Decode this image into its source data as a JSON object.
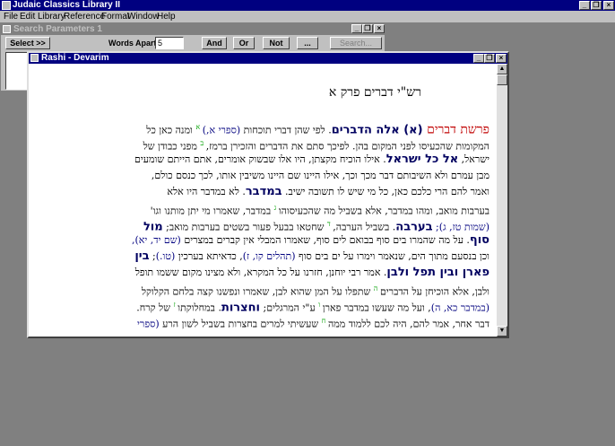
{
  "app": {
    "title": "Judaic Classics Library II",
    "menu": [
      "File",
      "Edit",
      "Library",
      "Reference",
      "Format",
      "Window",
      "Help"
    ]
  },
  "window_buttons": {
    "minimize": "_",
    "restore": "❐",
    "close": "×"
  },
  "search": {
    "title": "Search Parameters  1",
    "select_label": "Select >>",
    "words_apart_label": "Words Apart",
    "words_apart_value": "5",
    "and_label": "And",
    "or_label": "Or",
    "not_label": "Not",
    "ellipsis_label": "...",
    "search_label": "Search..."
  },
  "rashi": {
    "title": "Rashi - Devarim",
    "heading": "רש\"י דברים פרק א",
    "lines": [
      {
        "parts": [
          {
            "t": "פרשת דברים",
            "c": "parsha"
          },
          {
            "t": "  (א) ",
            "c": "bold large"
          },
          {
            "t": "אלה הדברים",
            "c": "bold large"
          },
          {
            "t": ". לפי שהן דברי תוכחות ",
            "c": ""
          },
          {
            "t": "(ספרי א,)",
            "c": "ref"
          },
          {
            "t": " א",
            "c": "sup"
          },
          {
            "t": " ומנה כאן כל",
            "c": ""
          }
        ]
      },
      {
        "parts": [
          {
            "t": "המקומות שהכעיסו לפני המקום בהן. לפיכך סתם את הדברים והזכירן ברמז,",
            "c": ""
          },
          {
            "t": " ב",
            "c": "sup"
          },
          {
            "t": " מפני כבודן של",
            "c": ""
          }
        ]
      },
      {
        "parts": [
          {
            "t": "ישראל, ",
            "c": ""
          },
          {
            "t": "אל כל ישראל",
            "c": "bold large"
          },
          {
            "t": ". אילו הוכיח מקצתן, היו אלו שבשוק אומרים, אתם הייתם שומעים",
            "c": ""
          }
        ]
      },
      {
        "parts": [
          {
            "t": "מבן עמרם ולא השיבותם דבר מכך וכך, אילו היינו שם היינו משיבין אותו, לכך כנסם כולם,",
            "c": ""
          }
        ]
      },
      {
        "parts": [
          {
            "t": "ואמר להם הרי כלכם כאן, כל מי שיש לו תשובה ישיב. ",
            "c": ""
          },
          {
            "t": "במדבר",
            "c": "bold large"
          },
          {
            "t": ". לא במדבר היו אלא",
            "c": ""
          }
        ]
      },
      {
        "parts": [
          {
            "t": "בערבות מואב, ומהו במדבר, אלא בשביל מה שהכעיסוהו",
            "c": ""
          },
          {
            "t": " ג",
            "c": "sup"
          },
          {
            "t": " במדבר, שאמרו מי יתן מותנו וגו'",
            "c": ""
          }
        ]
      },
      {
        "parts": [
          {
            "t": "(שמות טז, ג); ",
            "c": "ref"
          },
          {
            "t": "בערבה",
            "c": "bold large"
          },
          {
            "t": ". בשביל הערבה,",
            "c": ""
          },
          {
            "t": " ד",
            "c": "sup"
          },
          {
            "t": " שחטאו בבעל פעור בשטים בערבות מואב; ",
            "c": ""
          },
          {
            "t": "מול",
            "c": "bold large"
          }
        ]
      },
      {
        "parts": [
          {
            "t": "סוף",
            "c": "bold large"
          },
          {
            "t": ". על מה שהמרו בים סוף בבואם לים סוף, שאמרו המבלי אין קברים במצרים ",
            "c": ""
          },
          {
            "t": "(שם יד, יא),",
            "c": "ref"
          }
        ]
      },
      {
        "parts": [
          {
            "t": "וכן בנסעם מתוך הים, שנאמר וימרו על ים בים סוף ",
            "c": ""
          },
          {
            "t": "(תהלים קו, ז)",
            "c": "ref"
          },
          {
            "t": ", כדאיתא בערכין ",
            "c": ""
          },
          {
            "t": "(טו.)",
            "c": "ref"
          },
          {
            "t": "; ",
            "c": ""
          },
          {
            "t": "בין",
            "c": "bold large"
          }
        ]
      },
      {
        "parts": [
          {
            "t": "פארן ובין תפל ולבן",
            "c": "bold large"
          },
          {
            "t": ". אמר רבי יוחנן, חזרנו על כל המקרא, ולא מצינו מקום ששמו תופל",
            "c": ""
          }
        ]
      },
      {
        "parts": [
          {
            "t": "ולבן, אלא הוכיחן על הדברים",
            "c": ""
          },
          {
            "t": " ה",
            "c": "sup"
          },
          {
            "t": " שתפלו על המן שהוא לבן, שאמרו ונפשנו קצה בלחם הקלוקל",
            "c": ""
          }
        ]
      },
      {
        "parts": [
          {
            "t": "(במדבר כא, ה)",
            "c": "ref"
          },
          {
            "t": ", ועל מה שעשו במדבר פארן",
            "c": ""
          },
          {
            "t": " ו",
            "c": "sup"
          },
          {
            "t": " ע\"י המרגלים; ",
            "c": ""
          },
          {
            "t": "וחצרות",
            "c": "bold large"
          },
          {
            "t": ". במחלוקתו",
            "c": ""
          },
          {
            "t": " ז",
            "c": "sup"
          },
          {
            "t": " של קרח.",
            "c": ""
          }
        ]
      },
      {
        "parts": [
          {
            "t": "דבר אחר, אמר להם, היה לכם ללמוד ממה",
            "c": ""
          },
          {
            "t": " ח",
            "c": "sup"
          },
          {
            "t": " שעשיתי למרים בחצרות בשביל לשון הרע ",
            "c": ""
          },
          {
            "t": "(ספרי",
            "c": "ref"
          }
        ]
      }
    ]
  }
}
